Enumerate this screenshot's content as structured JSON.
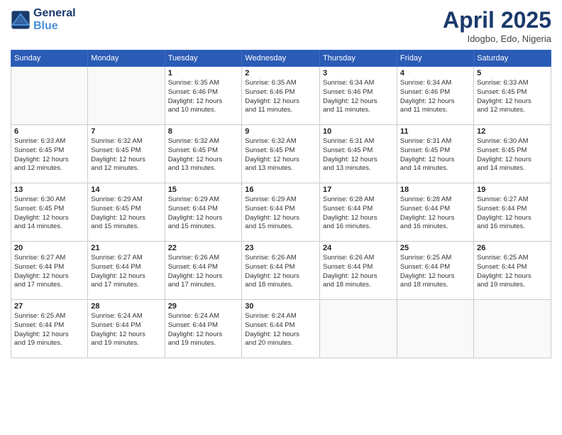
{
  "header": {
    "logo_line1": "General",
    "logo_line2": "Blue",
    "month": "April 2025",
    "location": "Idogbo, Edo, Nigeria"
  },
  "weekdays": [
    "Sunday",
    "Monday",
    "Tuesday",
    "Wednesday",
    "Thursday",
    "Friday",
    "Saturday"
  ],
  "weeks": [
    [
      {
        "day": "",
        "info": ""
      },
      {
        "day": "",
        "info": ""
      },
      {
        "day": "1",
        "info": "Sunrise: 6:35 AM\nSunset: 6:46 PM\nDaylight: 12 hours\nand 10 minutes."
      },
      {
        "day": "2",
        "info": "Sunrise: 6:35 AM\nSunset: 6:46 PM\nDaylight: 12 hours\nand 11 minutes."
      },
      {
        "day": "3",
        "info": "Sunrise: 6:34 AM\nSunset: 6:46 PM\nDaylight: 12 hours\nand 11 minutes."
      },
      {
        "day": "4",
        "info": "Sunrise: 6:34 AM\nSunset: 6:46 PM\nDaylight: 12 hours\nand 11 minutes."
      },
      {
        "day": "5",
        "info": "Sunrise: 6:33 AM\nSunset: 6:45 PM\nDaylight: 12 hours\nand 12 minutes."
      }
    ],
    [
      {
        "day": "6",
        "info": "Sunrise: 6:33 AM\nSunset: 6:45 PM\nDaylight: 12 hours\nand 12 minutes."
      },
      {
        "day": "7",
        "info": "Sunrise: 6:32 AM\nSunset: 6:45 PM\nDaylight: 12 hours\nand 12 minutes."
      },
      {
        "day": "8",
        "info": "Sunrise: 6:32 AM\nSunset: 6:45 PM\nDaylight: 12 hours\nand 13 minutes."
      },
      {
        "day": "9",
        "info": "Sunrise: 6:32 AM\nSunset: 6:45 PM\nDaylight: 12 hours\nand 13 minutes."
      },
      {
        "day": "10",
        "info": "Sunrise: 6:31 AM\nSunset: 6:45 PM\nDaylight: 12 hours\nand 13 minutes."
      },
      {
        "day": "11",
        "info": "Sunrise: 6:31 AM\nSunset: 6:45 PM\nDaylight: 12 hours\nand 14 minutes."
      },
      {
        "day": "12",
        "info": "Sunrise: 6:30 AM\nSunset: 6:45 PM\nDaylight: 12 hours\nand 14 minutes."
      }
    ],
    [
      {
        "day": "13",
        "info": "Sunrise: 6:30 AM\nSunset: 6:45 PM\nDaylight: 12 hours\nand 14 minutes."
      },
      {
        "day": "14",
        "info": "Sunrise: 6:29 AM\nSunset: 6:45 PM\nDaylight: 12 hours\nand 15 minutes."
      },
      {
        "day": "15",
        "info": "Sunrise: 6:29 AM\nSunset: 6:44 PM\nDaylight: 12 hours\nand 15 minutes."
      },
      {
        "day": "16",
        "info": "Sunrise: 6:29 AM\nSunset: 6:44 PM\nDaylight: 12 hours\nand 15 minutes."
      },
      {
        "day": "17",
        "info": "Sunrise: 6:28 AM\nSunset: 6:44 PM\nDaylight: 12 hours\nand 16 minutes."
      },
      {
        "day": "18",
        "info": "Sunrise: 6:28 AM\nSunset: 6:44 PM\nDaylight: 12 hours\nand 16 minutes."
      },
      {
        "day": "19",
        "info": "Sunrise: 6:27 AM\nSunset: 6:44 PM\nDaylight: 12 hours\nand 16 minutes."
      }
    ],
    [
      {
        "day": "20",
        "info": "Sunrise: 6:27 AM\nSunset: 6:44 PM\nDaylight: 12 hours\nand 17 minutes."
      },
      {
        "day": "21",
        "info": "Sunrise: 6:27 AM\nSunset: 6:44 PM\nDaylight: 12 hours\nand 17 minutes."
      },
      {
        "day": "22",
        "info": "Sunrise: 6:26 AM\nSunset: 6:44 PM\nDaylight: 12 hours\nand 17 minutes."
      },
      {
        "day": "23",
        "info": "Sunrise: 6:26 AM\nSunset: 6:44 PM\nDaylight: 12 hours\nand 18 minutes."
      },
      {
        "day": "24",
        "info": "Sunrise: 6:26 AM\nSunset: 6:44 PM\nDaylight: 12 hours\nand 18 minutes."
      },
      {
        "day": "25",
        "info": "Sunrise: 6:25 AM\nSunset: 6:44 PM\nDaylight: 12 hours\nand 18 minutes."
      },
      {
        "day": "26",
        "info": "Sunrise: 6:25 AM\nSunset: 6:44 PM\nDaylight: 12 hours\nand 19 minutes."
      }
    ],
    [
      {
        "day": "27",
        "info": "Sunrise: 6:25 AM\nSunset: 6:44 PM\nDaylight: 12 hours\nand 19 minutes."
      },
      {
        "day": "28",
        "info": "Sunrise: 6:24 AM\nSunset: 6:44 PM\nDaylight: 12 hours\nand 19 minutes."
      },
      {
        "day": "29",
        "info": "Sunrise: 6:24 AM\nSunset: 6:44 PM\nDaylight: 12 hours\nand 19 minutes."
      },
      {
        "day": "30",
        "info": "Sunrise: 6:24 AM\nSunset: 6:44 PM\nDaylight: 12 hours\nand 20 minutes."
      },
      {
        "day": "",
        "info": ""
      },
      {
        "day": "",
        "info": ""
      },
      {
        "day": "",
        "info": ""
      }
    ]
  ]
}
